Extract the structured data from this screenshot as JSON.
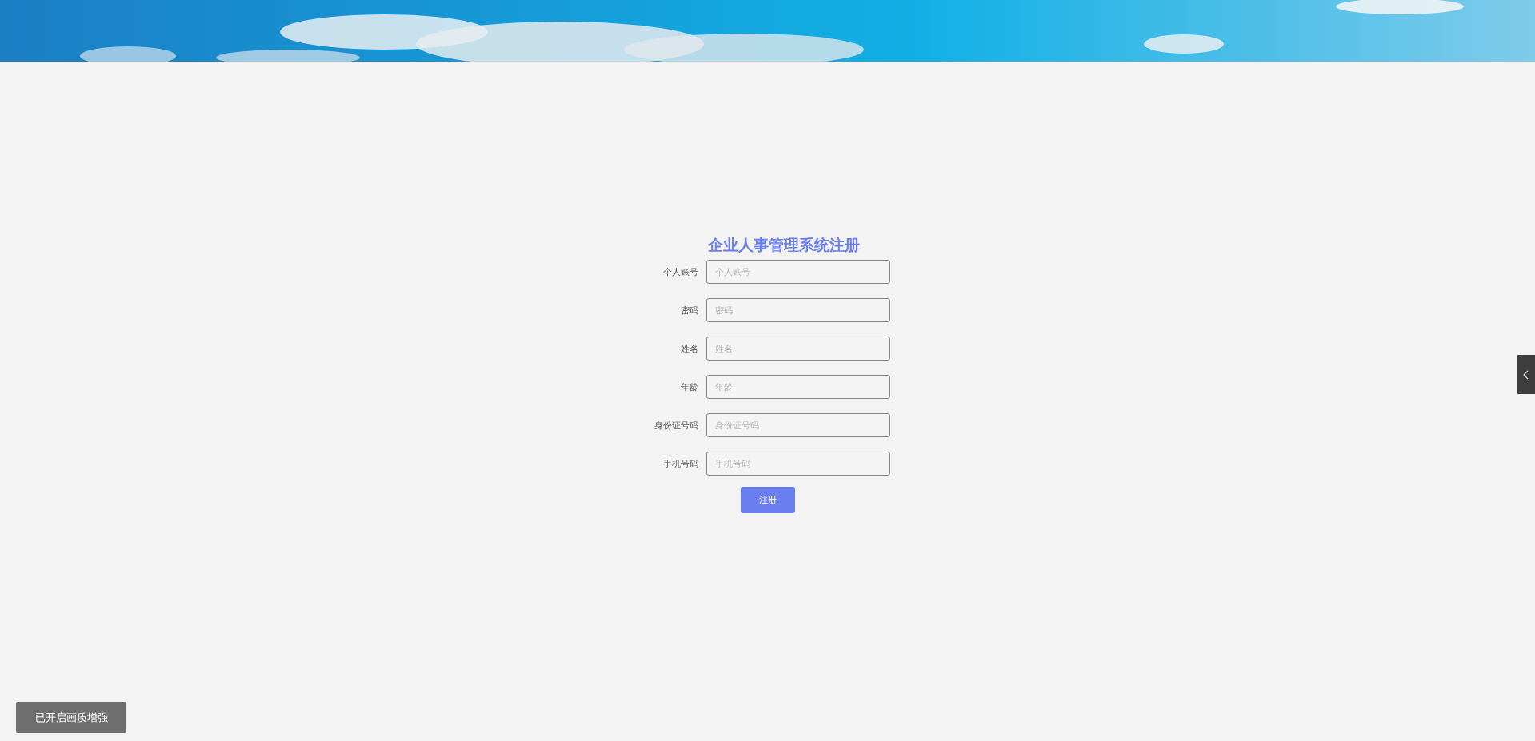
{
  "title": "企业人事管理系统注册",
  "fields": [
    {
      "label": "个人账号",
      "placeholder": "个人账号"
    },
    {
      "label": "密码",
      "placeholder": "密码"
    },
    {
      "label": "姓名",
      "placeholder": "姓名"
    },
    {
      "label": "年龄",
      "placeholder": "年龄"
    },
    {
      "label": "身份证号码",
      "placeholder": "身份证号码"
    },
    {
      "label": "手机号码",
      "placeholder": "手机号码"
    }
  ],
  "submit_button": "注册",
  "enhance_button": "已开启画质增强"
}
